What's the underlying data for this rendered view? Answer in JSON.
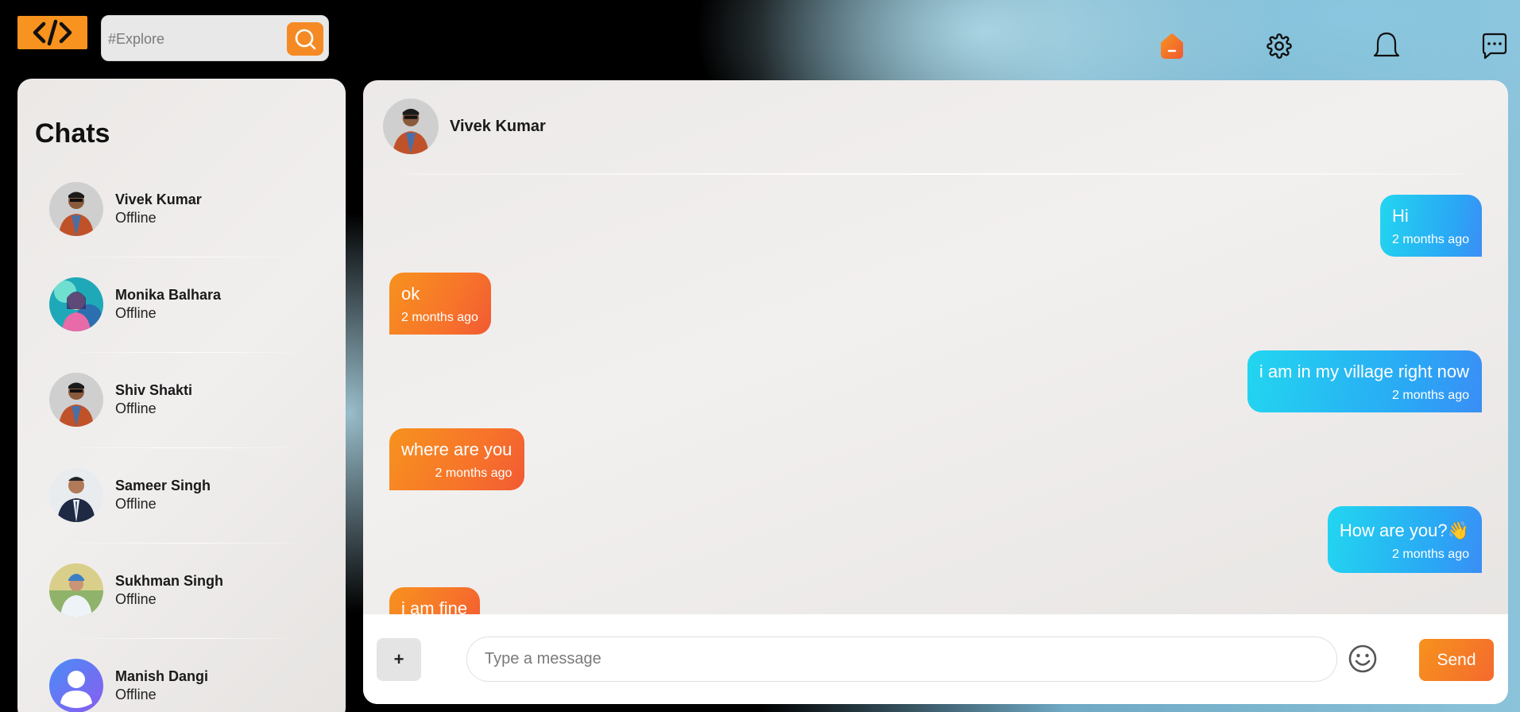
{
  "header": {
    "logo_icon": "code-brackets-icon",
    "search": {
      "placeholder": "#Explore",
      "value": ""
    },
    "nav_icons": [
      "home-icon",
      "gear-icon",
      "bell-icon",
      "chat-bubble-icon"
    ]
  },
  "sidebar": {
    "title": "Chats",
    "chats": [
      {
        "name": "Vivek Kumar",
        "status": "Offline"
      },
      {
        "name": "Monika Balhara",
        "status": "Offline"
      },
      {
        "name": "Shiv Shakti",
        "status": "Offline"
      },
      {
        "name": "Sameer Singh",
        "status": "Offline"
      },
      {
        "name": "Sukhman Singh",
        "status": "Offline"
      },
      {
        "name": "Manish Dangi",
        "status": "Offline"
      }
    ]
  },
  "conversation": {
    "contact_name": "Vivek Kumar",
    "messages": [
      {
        "direction": "out",
        "text": "Hi",
        "time": "2 months ago"
      },
      {
        "direction": "in",
        "text": "ok",
        "time": "2 months ago"
      },
      {
        "direction": "out",
        "text": "i am in my village right now",
        "time": "2 months ago"
      },
      {
        "direction": "in",
        "text": "where are you",
        "time": "2 months ago"
      },
      {
        "direction": "out",
        "text": "How are you?👋",
        "time": "2 months ago"
      },
      {
        "direction": "in",
        "text": "i am fine",
        "time": ""
      }
    ]
  },
  "composer": {
    "attach_label": "+",
    "placeholder": "Type a message",
    "value": "",
    "send_label": "Send"
  },
  "colors": {
    "accent_orange": "#f7921e",
    "outgoing_blue": "#22d6ef",
    "incoming_orange": "#f7742a"
  }
}
